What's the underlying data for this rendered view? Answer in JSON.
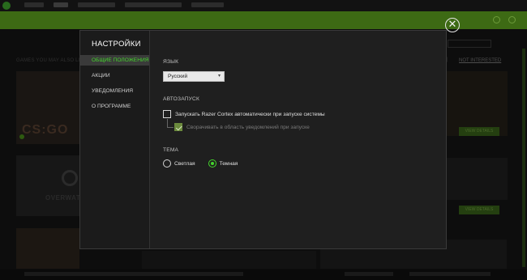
{
  "background": {
    "games_label": "GAMES YOU MAY ALSO LIKE",
    "not_interested": "NOT INTERESTED",
    "view_details": "VIEW DETAILS",
    "csgo_logo": "CS:GO",
    "overwatch_logo": "OVERWATCH"
  },
  "dialog": {
    "close_icon": "✕",
    "sidebar": {
      "title": "НАСТРОЙКИ",
      "items": [
        {
          "label": "ОБЩИЕ ПОЛОЖЕНИЯ",
          "active": true
        },
        {
          "label": "АКЦИИ",
          "active": false
        },
        {
          "label": "УВЕДОМЛЕНИЯ",
          "active": false
        },
        {
          "label": "О ПРОГРАММЕ",
          "active": false
        }
      ]
    },
    "language": {
      "title": "ЯЗЫК",
      "selected": "Русский"
    },
    "autostart": {
      "title": "АВТОЗАПУСК",
      "launch_label": "Запускать Razer Cortex автоматически при запуске системы",
      "launch_checked": false,
      "minimize_label": "Сворачивать в область уведомлений при запуске",
      "minimize_checked": true
    },
    "theme": {
      "title": "ТЕМА",
      "options": [
        {
          "label": "Светлая",
          "selected": false
        },
        {
          "label": "Темная",
          "selected": true
        }
      ]
    }
  },
  "colors": {
    "accent": "#44d62c",
    "dialog_bg": "#1f1f1f"
  }
}
